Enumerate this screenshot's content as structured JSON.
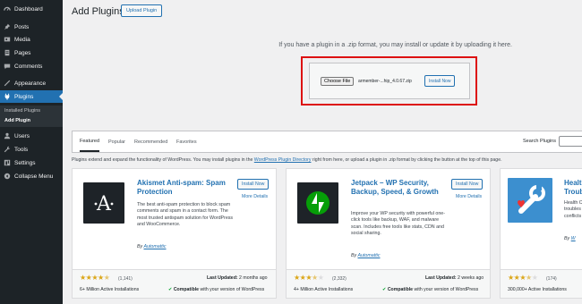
{
  "sidebar": {
    "items": [
      {
        "label": "Dashboard",
        "icon": "dashboard-icon"
      },
      {
        "label": "Posts",
        "icon": "pin-icon"
      },
      {
        "label": "Media",
        "icon": "media-icon"
      },
      {
        "label": "Pages",
        "icon": "pages-icon"
      },
      {
        "label": "Comments",
        "icon": "comments-icon"
      },
      {
        "label": "Appearance",
        "icon": "appearance-icon"
      },
      {
        "label": "Plugins",
        "icon": "plugins-icon"
      },
      {
        "label": "Users",
        "icon": "users-icon"
      },
      {
        "label": "Tools",
        "icon": "tools-icon"
      },
      {
        "label": "Settings",
        "icon": "settings-icon"
      },
      {
        "label": "Collapse Menu",
        "icon": "collapse-icon"
      }
    ],
    "submenu": [
      {
        "label": "Installed Plugins"
      },
      {
        "label": "Add Plugin"
      }
    ]
  },
  "header": {
    "title": "Add Plugins",
    "upload_label": "Upload Plugin"
  },
  "upload": {
    "note": "If you have a plugin in a .zip format, you may install or update it by uploading it here.",
    "choose_label": "Choose File",
    "file_name": "armember-...hip_4.0.67.zip",
    "install_label": "Install Now"
  },
  "filters": {
    "tabs": [
      "Featured",
      "Popular",
      "Recommended",
      "Favorites"
    ],
    "search_label": "Search Plugins"
  },
  "intro": {
    "before": "Plugins extend and expand the functionality of WordPress. You may install plugins in the ",
    "link": "WordPress Plugin Directory",
    "after": " right from here, or upload a plugin in .zip format by clicking the button at the top of this page."
  },
  "plugins": [
    {
      "name": "Akismet Anti-spam: Spam Protection",
      "description": "The best anti-spam protection to block spam comments and spam in a contact form. The most trusted antispam solution for WordPress and WooCommerce.",
      "by": "By",
      "author": "Automattic",
      "install_label": "Install Now",
      "more_label": "More Details",
      "rating": 4.5,
      "rating_count": "(1,141)",
      "installs": "6+ Million Active Installations",
      "updated_label": "Last Updated:",
      "updated_value": "2 months ago",
      "compat_strong": "Compatible",
      "compat_rest": "with your version of WordPress",
      "icon_color": "#1e2328"
    },
    {
      "name": "Jetpack – WP Security, Backup, Speed, & Growth",
      "description": "Improve your WP security with powerful one-click tools like backup, WAF, and malware scan. Includes free tools like stats, CDN and social sharing.",
      "by": "By",
      "author": "Automattic",
      "install_label": "Install Now",
      "more_label": "More Details",
      "rating": 3.5,
      "rating_count": "(2,332)",
      "installs": "4+ Million Active Installations",
      "updated_label": "Last Updated:",
      "updated_value": "2 weeks ago",
      "compat_strong": "Compatible",
      "compat_rest": "with your version of WordPress",
      "icon_color": "#1e2328"
    },
    {
      "name": "Healt Troub",
      "description": "Health C troubles conflicts",
      "by": "By",
      "author": "W",
      "rating": 3.5,
      "rating_count": "(174)",
      "installs": "300,000+ Active Installations",
      "icon_color": "#3c8fcf"
    }
  ],
  "colors": {
    "sidebar_bg": "#1d2327",
    "accent": "#2271b1",
    "highlight_border": "#dd1111",
    "star": "#dba617"
  }
}
